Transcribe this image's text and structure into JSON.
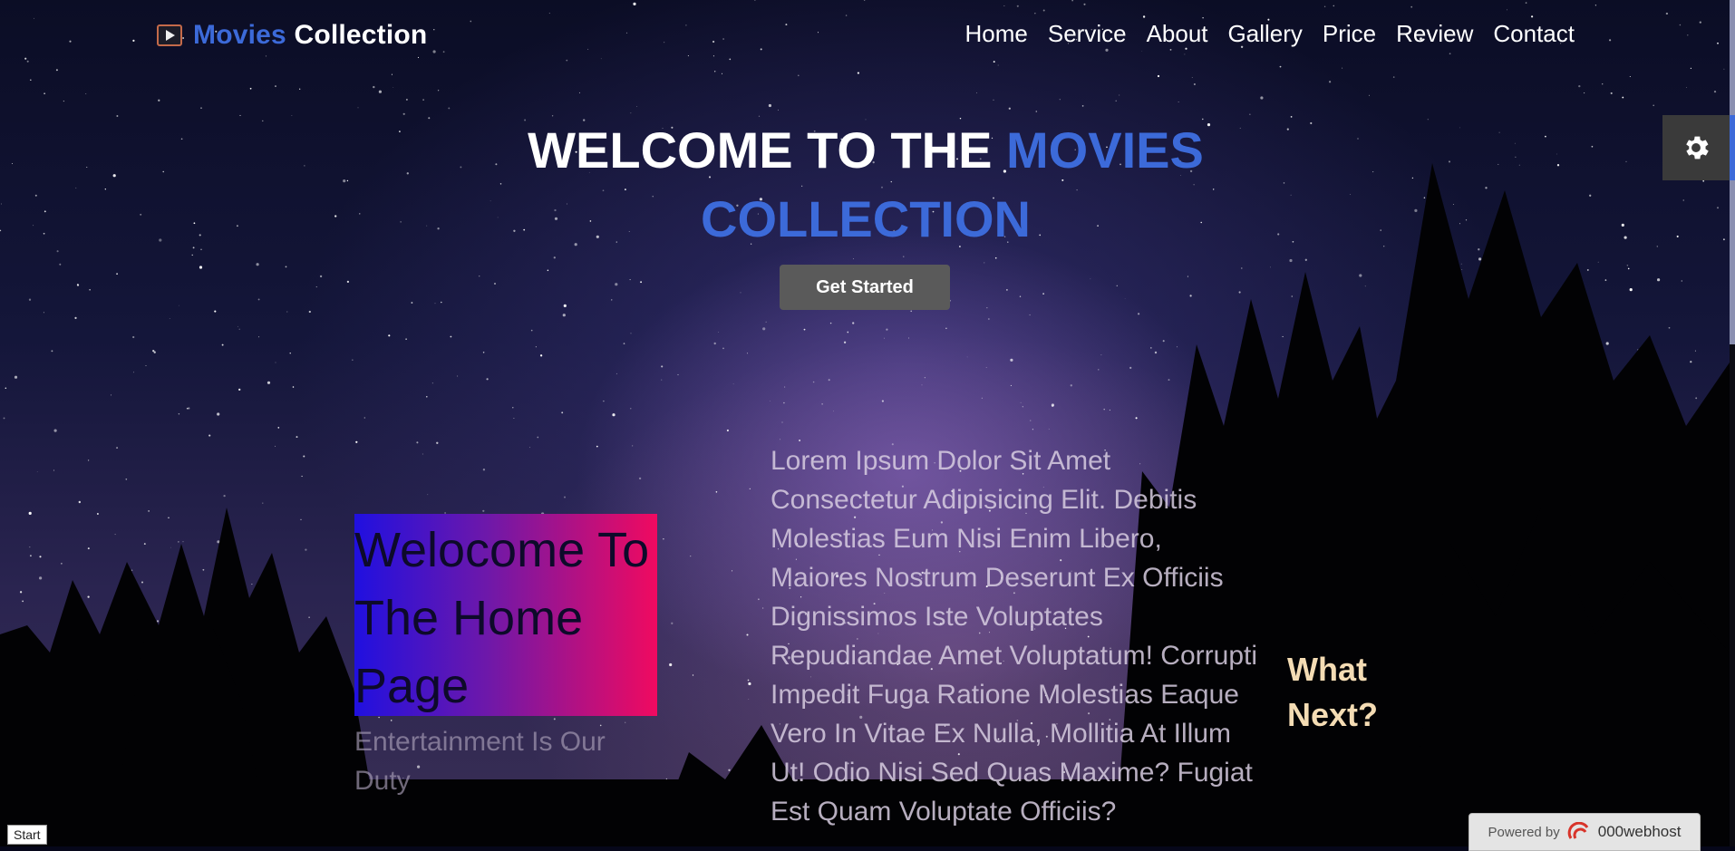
{
  "brand": {
    "part1": "Movies",
    "part2": "Collection",
    "icon": "film-play-icon"
  },
  "nav": {
    "items": [
      {
        "label": "Home"
      },
      {
        "label": "Service"
      },
      {
        "label": "About"
      },
      {
        "label": "Gallery"
      },
      {
        "label": "Price"
      },
      {
        "label": "Review"
      },
      {
        "label": "Contact"
      }
    ]
  },
  "hero": {
    "title_white": "WELCOME TO THE",
    "title_blue_1": "MOVIES",
    "title_blue_2": "COLLECTION",
    "cta_label": "Get Started"
  },
  "home": {
    "welcome": "Welocome To The Home Page",
    "tagline": "Entertainment Is Our Duty"
  },
  "lorem": "Lorem Ipsum Dolor Sit Amet Consectetur Adipisicing Elit. Debitis Molestias Eum Nisi Enim Libero, Maiores Nostrum Deserunt Ex Officiis Dignissimos Iste Voluptates Repudiandae Amet Voluptatum! Corrupti Impedit Fuga Ratione Molestias Eaque Vero In Vitae Ex Nulla, Mollitia At Illum Ut! Odio Nisi Sed Quas Maxime? Fugiat Est Quam Voluptate Officiis?",
  "what_next": "What Next?",
  "settings_icon": "gear-icon",
  "start_label": "Start",
  "powered": {
    "prefix": "Powered by",
    "brand": "000webhost"
  },
  "colors": {
    "accent": "#3c6ad9",
    "cta_bg": "#5a5a5a",
    "gradient_start": "#2010e0",
    "gradient_end": "#f00a60",
    "what_next": "#f4dcb4"
  }
}
